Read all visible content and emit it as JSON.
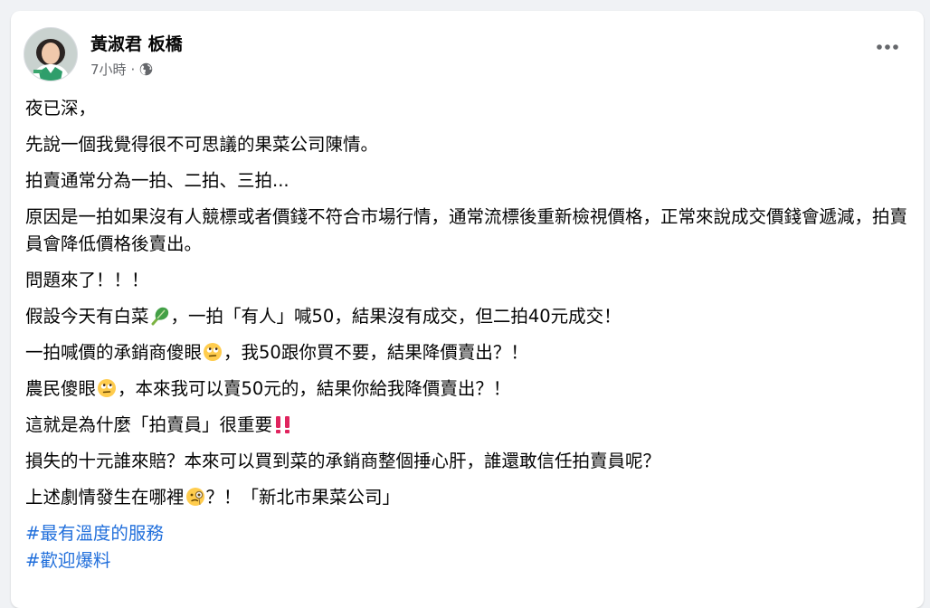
{
  "post": {
    "author": "黃淑君 板橋",
    "timestamp": "7小時",
    "meta_separator": "·",
    "privacy_icon": "globe-icon",
    "more_icon": "more-options-icon"
  },
  "content": {
    "p1": "夜已深，",
    "p2": "先說一個我覺得很不可思議的果菜公司陳情。",
    "p3": "拍賣通常分為一拍、二拍、三拍...",
    "p4": "原因是一拍如果沒有人競標或者價錢不符合市場行情，通常流標後重新檢視價格，正常來說成交價錢會遞減，拍賣員會降低價格後賣出。",
    "p5": "問題來了！！！",
    "p6a": "假設今天有白菜",
    "p6b": "，一拍「有人」喊50，結果沒有成交，但二拍40元成交！",
    "p7a": "一拍喊價的承銷商傻眼",
    "p7b": "，我50跟你買不要，結果降價賣出？！",
    "p8a": "農民傻眼",
    "p8b": "，本來我可以賣50元的，結果你給我降價賣出？！",
    "p9": "這就是為什麼「拍賣員」很重要",
    "p10": "損失的十元誰來賠？本來可以買到菜的承銷商整個捶心肝，誰還敢信任拍賣員呢？",
    "p11a": "上述劇情發生在哪裡",
    "p11b": "？！「新北市果菜公司」"
  },
  "hashtags": [
    "#最有溫度的服務",
    "#歡迎爆料"
  ],
  "colors": {
    "background": "#f0f2f5",
    "card": "#ffffff",
    "text": "#050505",
    "secondary_text": "#65676b",
    "hashtag": "#216fdb",
    "exclamation": "#e0245e"
  }
}
